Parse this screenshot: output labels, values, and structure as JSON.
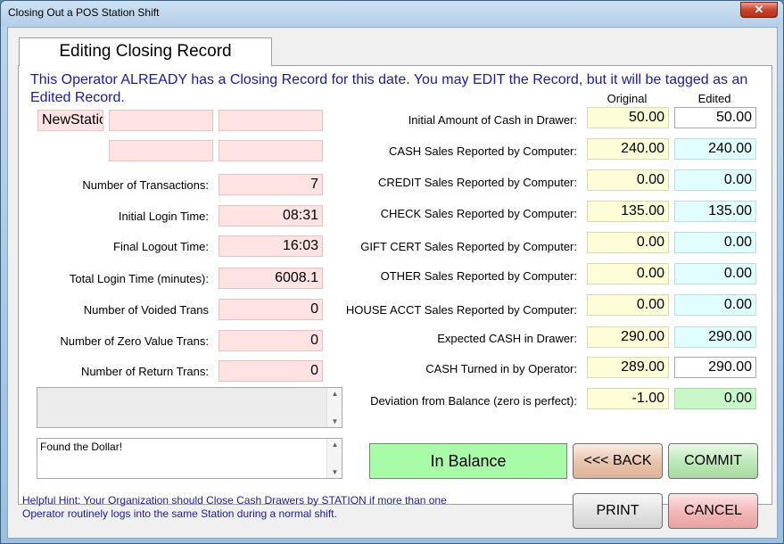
{
  "window": {
    "title": "Closing Out a POS Station Shift",
    "close_glyph": "✕"
  },
  "tab": {
    "label": "Editing Closing Record"
  },
  "notice": "This Operator ALREADY has a Closing Record for this date.  You may EDIT the Record, but it will be tagged as an Edited Record.",
  "columns": {
    "original": "Original",
    "edited": "Edited"
  },
  "operator": {
    "station": "NewStation",
    "field2": "",
    "field3": "",
    "field4": "",
    "field5": ""
  },
  "stats": [
    {
      "label": "Number of Transactions:",
      "value": "7"
    },
    {
      "label": "Initial Login Time:",
      "value": "08:31"
    },
    {
      "label": "Final Logout Time:",
      "value": "16:03"
    },
    {
      "label": "Total Login Time (minutes):",
      "value": "6008.1"
    },
    {
      "label": "Number of Voided Trans",
      "value": "0"
    },
    {
      "label": "Number of Zero Value Trans:",
      "value": "0"
    },
    {
      "label": "Number of Return Trans:",
      "value": "0"
    }
  ],
  "money": [
    {
      "label": "Initial Amount of Cash in Drawer:",
      "original": "50.00",
      "edited": "50.00"
    },
    {
      "label": "CASH Sales Reported by Computer:",
      "original": "240.00",
      "edited": "240.00"
    },
    {
      "label": "CREDIT Sales Reported by Computer:",
      "original": "0.00",
      "edited": "0.00"
    },
    {
      "label": "CHECK Sales Reported by Computer:",
      "original": "135.00",
      "edited": "135.00"
    },
    {
      "label": "GIFT CERT Sales Reported by Computer:",
      "original": "0.00",
      "edited": "0.00"
    },
    {
      "label": "OTHER Sales Reported by Computer:",
      "original": "0.00",
      "edited": "0.00"
    },
    {
      "label": "HOUSE ACCT Sales Reported by Computer:",
      "original": "0.00",
      "edited": "0.00"
    },
    {
      "label": "Expected CASH in Drawer:",
      "original": "290.00",
      "edited": "290.00"
    },
    {
      "label": "CASH Turned in by Operator:",
      "original": "289.00",
      "edited": "290.00"
    },
    {
      "label": "Deviation from Balance (zero is perfect):",
      "original": "-1.00",
      "edited": "0.00"
    }
  ],
  "memo_top": "",
  "memo_notes": "Found the Dollar!",
  "status": "In Balance",
  "buttons": {
    "back": "<<< BACK",
    "commit": "COMMIT",
    "print": "PRINT",
    "cancel": "CANCEL"
  },
  "hint": "Helpful Hint:  Your Organization should Close Cash Drawers by STATION if more than one Operator routinely logs into the same Station during a normal shift.",
  "colors": {
    "pink": "#ffe2e2",
    "yellow": "#fdfdd8",
    "cyan": "#e0fefe",
    "balance_green": "#a8fca8",
    "hint_blue": "#1a1aa8"
  }
}
